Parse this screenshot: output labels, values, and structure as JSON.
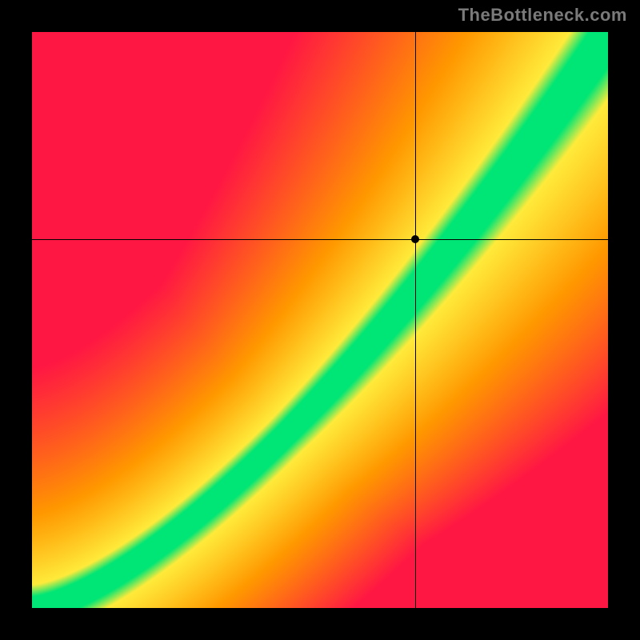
{
  "watermark": "TheBottleneck.com",
  "chart_data": {
    "type": "heatmap",
    "title": "",
    "xlabel": "",
    "ylabel": "",
    "xlim": [
      0,
      1
    ],
    "ylim": [
      0,
      1
    ],
    "marker": {
      "x": 0.665,
      "y": 0.64
    },
    "crosshair": {
      "x": 0.665,
      "y": 0.64
    },
    "colors": {
      "low_mismatch": "#ff1744",
      "mid": "#ffeb3b",
      "optimal": "#00e676",
      "mid_high": "#ff9800"
    },
    "description": "Heatmap showing an optimal green band along a curved diagonal (roughly y ≈ x^(1.4)), transitioning through yellow to red/orange away from the band. A crosshair and dot mark a specific point slightly right of the optimal band at approximately (0.665, 0.640).",
    "optimal_curve": {
      "form": "y = x^1.4",
      "samples_x": [
        0.0,
        0.1,
        0.2,
        0.3,
        0.4,
        0.5,
        0.6,
        0.7,
        0.8,
        0.9,
        1.0
      ],
      "samples_y": [
        0.0,
        0.04,
        0.105,
        0.186,
        0.278,
        0.379,
        0.489,
        0.607,
        0.732,
        0.863,
        1.0
      ]
    }
  }
}
